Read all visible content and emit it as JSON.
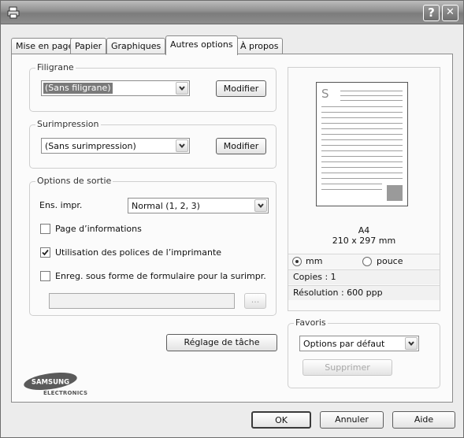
{
  "titlebar": {
    "help": "?",
    "close": "✕"
  },
  "tabs": [
    {
      "label": "Mise en page",
      "active": false
    },
    {
      "label": "Papier",
      "active": false
    },
    {
      "label": "Graphiques",
      "active": false
    },
    {
      "label": "Autres options",
      "active": true
    },
    {
      "label": "À propos",
      "active": false
    }
  ],
  "watermark": {
    "label": "Filigrane",
    "value": "(Sans filigrane)",
    "button": "Modifier"
  },
  "overlay": {
    "label": "Surimpression",
    "value": "(Sans surimpression)",
    "button": "Modifier"
  },
  "output": {
    "label": "Options de sortie",
    "print_order_label": "Ens. impr.",
    "print_order_value": "Normal (1, 2, 3)",
    "info_page": {
      "label": "Page d’informations",
      "checked": false
    },
    "printer_fonts": {
      "label": "Utilisation des polices de l’imprimante",
      "checked": true
    },
    "save_overlay": {
      "label": "Enreg. sous forme de formulaire pour la surimpr.",
      "checked": false
    },
    "path_value": "",
    "browse_button": "..."
  },
  "job_button": "Réglage de tâche",
  "preview": {
    "page_letter": "S",
    "paper_name": "A4",
    "paper_size": "210 x 297 mm",
    "unit_mm": "mm",
    "unit_inch": "pouce",
    "copies": "Copies : 1",
    "resolution": "Résolution : 600 ppp"
  },
  "favorites": {
    "label": "Favoris",
    "value": "Options par défaut",
    "delete_button": "Supprimer"
  },
  "logo": {
    "brand": "SAMSUNG",
    "sub": "ELECTRONICS"
  },
  "footer": {
    "ok": "OK",
    "cancel": "Annuler",
    "help": "Aide"
  }
}
